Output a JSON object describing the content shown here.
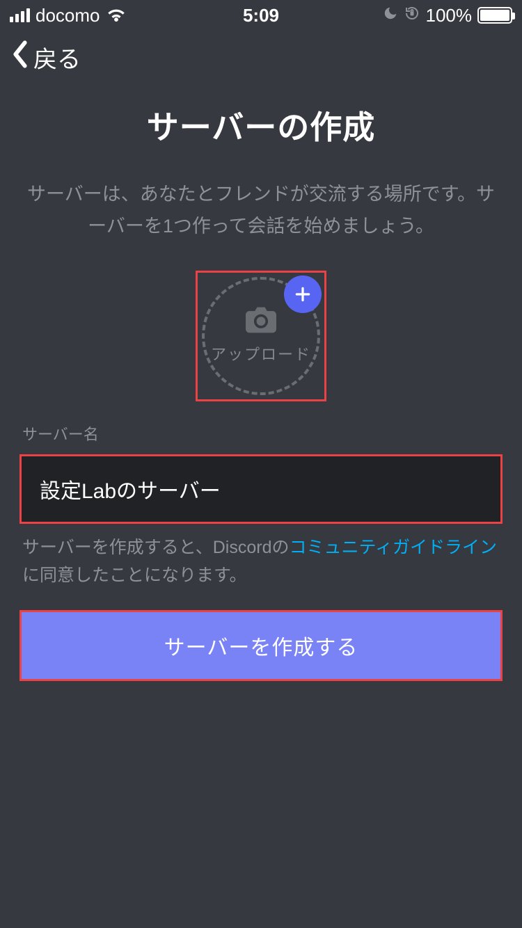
{
  "status": {
    "carrier": "docomo",
    "time": "5:09",
    "battery_pct": "100%"
  },
  "nav": {
    "back_label": "戻る"
  },
  "page": {
    "title": "サーバーの作成",
    "subtitle": "サーバーは、あなたとフレンドが交流する場所です。サーバーを1つ作って会話を始めましょう。"
  },
  "upload": {
    "label": "アップロード"
  },
  "server_name": {
    "label": "サーバー名",
    "value": "設定Labのサーバー"
  },
  "terms": {
    "prefix": "サーバーを作成すると、Discordの",
    "link": "コミュニティガイドライン",
    "suffix": "に同意したことになります。"
  },
  "create_button": {
    "label": "サーバーを作成する"
  },
  "colors": {
    "bg": "#36393f",
    "input_bg": "#202225",
    "muted": "#8e9297",
    "accent": "#5865f2",
    "button": "#7983f5",
    "link": "#00aff4",
    "highlight_border": "#ed4245"
  }
}
